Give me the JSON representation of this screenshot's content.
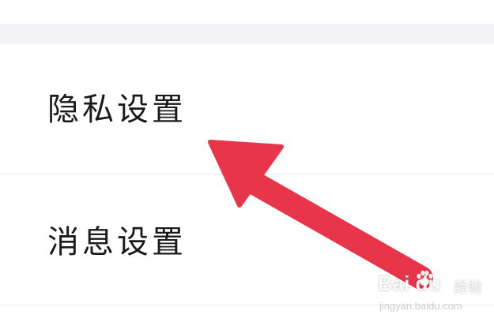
{
  "settings_list": {
    "items": [
      {
        "label": "隐私设置"
      },
      {
        "label": "消息设置"
      }
    ]
  },
  "annotation": {
    "arrow_color": "#e8354a",
    "points_to": "隐私设置"
  },
  "watermark": {
    "brand": "Bai du",
    "subtitle": "经验",
    "url": "jingyan.baidu.com"
  },
  "colors": {
    "background": "#ffffff",
    "section_gap": "#f4f4f8",
    "divider": "#ececec",
    "text": "#1a1a1a"
  }
}
